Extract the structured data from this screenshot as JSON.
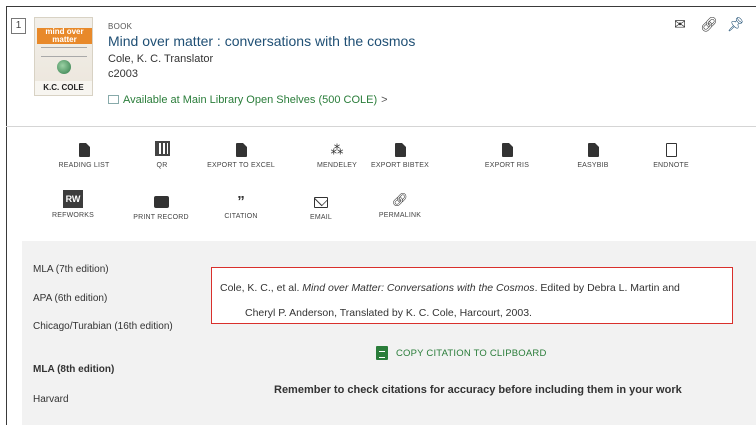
{
  "record": {
    "number": "1",
    "cover_title": "mind over matter",
    "cover_author": "K.C. COLE",
    "type": "BOOK",
    "title": "Mind over matter : conversations with the cosmos",
    "author": "Cole, K. C. Translator",
    "date": "c2003",
    "availability_prefix": "Available at",
    "availability_location": "Main Library  Open Shelves (500 COLE)",
    "availability_chevron": ">"
  },
  "top_actions": {
    "email_icon": "envelope-icon",
    "link_icon": "link-icon",
    "pin_icon": "pin-icon"
  },
  "tools": [
    {
      "label": "READING LIST",
      "icon": "document-icon"
    },
    {
      "label": "QR",
      "icon": "qr-icon"
    },
    {
      "label": "EXPORT TO EXCEL",
      "icon": "excel-icon"
    },
    {
      "label": "MENDELEY",
      "icon": "mendeley-icon"
    },
    {
      "label": "EXPORT BIBTEX",
      "icon": "document-icon"
    },
    {
      "label": "EXPORT RIS",
      "icon": "document-icon"
    },
    {
      "label": "EASYBIB",
      "icon": "document-icon"
    },
    {
      "label": "ENDNOTE",
      "icon": "document-outline-icon"
    },
    {
      "label": "REFWORKS",
      "icon": "refworks-icon",
      "badge": "RW"
    },
    {
      "label": "PRINT RECORD",
      "icon": "print-icon"
    },
    {
      "label": "CITATION",
      "icon": "quote-icon",
      "glyph": "”"
    },
    {
      "label": "EMAIL",
      "icon": "envelope-icon"
    },
    {
      "label": "PERMALINK",
      "icon": "link-icon"
    }
  ],
  "citation_styles": [
    {
      "label": "MLA (7th edition)"
    },
    {
      "label": "APA (6th edition)"
    },
    {
      "label": "Chicago/Turabian (16th edition)"
    },
    {
      "label": "MLA (8th edition)",
      "active": true
    },
    {
      "label": "Harvard"
    }
  ],
  "citation": {
    "before": "Cole, K. C., et al. ",
    "italic": "Mind over Matter: Conversations with the Cosmos",
    "after": ". Edited by Debra L. Martin and",
    "line2": "Cheryl P. Anderson, Translated by K. C. Cole, Harcourt, 2003."
  },
  "copy_button": "COPY CITATION TO CLIPBOARD",
  "reminder": "Remember to check citations for accuracy before including them in your work",
  "colors": {
    "title": "#1f4f74",
    "available": "#2a7d3a",
    "citation_border": "#d9302c",
    "panel_bg": "#f2f2f2"
  }
}
